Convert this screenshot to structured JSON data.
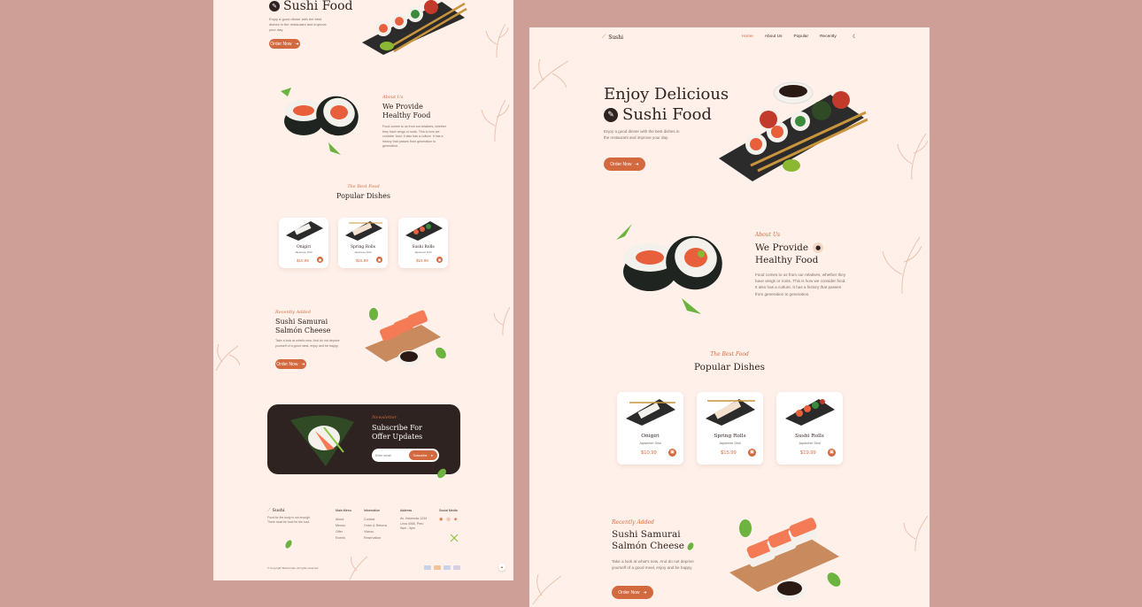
{
  "left": {
    "hero": {
      "title": "Sushi Food",
      "description": "Enjoy a good dinner with the best dishes in the restaurant and improve your day.",
      "button": "Order Now"
    },
    "about": {
      "eyebrow": "About Us",
      "title_line1": "We Provide",
      "title_line2": "Healthy Food",
      "text": "Food comes to us from our relatives, whether they have wings or roots. This is how we consider food. It also has a culture. It has a history that passes from generation to generation."
    },
    "popular": {
      "eyebrow": "The Best Food",
      "title": "Popular Dishes",
      "dishes": [
        {
          "name": "Onigiri",
          "type": "Japanese Dish",
          "price": "$10.99"
        },
        {
          "name": "Spring Rolls",
          "type": "Japanese Dish",
          "price": "$15.99"
        },
        {
          "name": "Sushi Rolls",
          "type": "Japanese Dish",
          "price": "$19.99"
        }
      ]
    },
    "recent": {
      "eyebrow": "Recently Added",
      "title_line1": "Sushi Samurai",
      "title_line2": "Salmón Cheese",
      "text": "Take a look at what's new. And do not deprive yourself of a good meal, enjoy and be happy.",
      "button": "Order Now"
    },
    "newsletter": {
      "eyebrow": "Newsletter",
      "title_line1": "Subscribe For",
      "title_line2": "Offer Updates",
      "placeholder": "Enter email",
      "button": "Subscribe"
    },
    "footer": {
      "logo": "Sushi",
      "tagline": "Food for the body is not enough. There must be food for the soul.",
      "col1_title": "Main Menu",
      "col1": [
        "About",
        "Menus",
        "Offer",
        "Events"
      ],
      "col2_title": "Information",
      "col2": [
        "Contact",
        "Order & Returns",
        "Videos",
        "Reservation"
      ],
      "col3_title": "Address",
      "col3": [
        "Av. Hacienda 1234",
        "Lima 4065, Perú",
        "9am - 9pm"
      ],
      "col4_title": "Social Media",
      "copyright": "© Copyright Bedimcode. All rights reserved"
    }
  },
  "right": {
    "nav": {
      "logo": "Sushi",
      "items": [
        "Home",
        "About Us",
        "Popular",
        "Recently"
      ]
    },
    "hero": {
      "title_line1": "Enjoy Delicious",
      "title_line2": "Sushi Food",
      "description": "Enjoy a good dinner with the best dishes in the restaurant and improve your day.",
      "button": "Order Now"
    },
    "about": {
      "eyebrow": "About Us",
      "title_line1": "We Provide",
      "title_line2": "Healthy Food",
      "text": "Food comes to us from our relatives, whether they have wings or roots. This is how we consider food. It also has a culture. It has a history that passes from generation to generation."
    },
    "popular": {
      "eyebrow": "The Best Food",
      "title": "Popular Dishes",
      "dishes": [
        {
          "name": "Onigiri",
          "type": "Japanese Dish",
          "price": "$10.99"
        },
        {
          "name": "Spring Rolls",
          "type": "Japanese Dish",
          "price": "$15.99"
        },
        {
          "name": "Sushi Rolls",
          "type": "Japanese Dish",
          "price": "$19.99"
        }
      ]
    },
    "recent": {
      "eyebrow": "Recently Added",
      "title_line1": "Sushi Samurai",
      "title_line2": "Salmón Cheese",
      "text": "Take a look at what's new. And do not deprive yourself of a good meal, enjoy and be happy.",
      "button": "Order Now"
    }
  },
  "colors": {
    "background": "#cd9f97",
    "page": "#fff1ea",
    "accent": "#d2693f",
    "dark": "#2e2320"
  },
  "icons": {
    "logo": "sushi-chopsticks-icon",
    "theme_toggle": "moon-icon",
    "button_arrow": "arrow-right-icon",
    "cart": "shopping-bag-icon",
    "subscribe": "send-icon"
  }
}
